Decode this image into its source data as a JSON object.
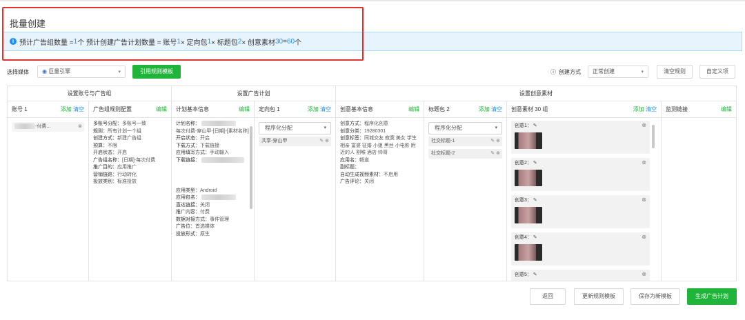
{
  "page_title": "批量创建",
  "alert": {
    "t1": "预计广告组数量 = ",
    "n1": "1",
    "t2": " 个    预计创建广告计划数量 = 账号 ",
    "n2": "1",
    "t3": " × 定向包 ",
    "n3": "1",
    "t4": " × 标题包 ",
    "n4": "2",
    "t5": " × 创意素材 ",
    "n5": "30",
    "t6": " = ",
    "n6": "60",
    "t7": " 个"
  },
  "toolbar": {
    "media_label": "选择媒体",
    "media_value": "巨量引擎",
    "template_btn": "引用规则模板",
    "help_label": "创建方式",
    "mode_value": "正常创建",
    "clear_btn": "清空规则",
    "custom_btn": "自定义项"
  },
  "groups": {
    "g1": "设置账号与广告组",
    "g2": "设置广告计划",
    "g3": "设置创意素材"
  },
  "cols": {
    "account": {
      "title": "账号 1",
      "add": "添加",
      "clear": "清空",
      "item_suffix": "-付费..."
    },
    "adgroup": {
      "title": "广告组规则配置",
      "edit": "编辑",
      "rows": [
        [
          "多账号分配：",
          "多账号一致"
        ],
        [
          "规则：",
          "所有计划一个组"
        ],
        [
          "创建方式：",
          "新建广告组"
        ],
        [
          "预算：",
          "不限"
        ],
        [
          "开启状态：",
          "开启"
        ],
        [
          "广告组名称：",
          "[日期]-每次付费"
        ],
        [
          "推广目的：",
          "应用推广"
        ],
        [
          "营销链路：",
          "行动转化"
        ],
        [
          "投放类别：",
          "标准投放"
        ]
      ]
    },
    "plan": {
      "title": "计划基本信息",
      "edit": "编辑",
      "rows": [
        [
          "计划名称：",
          ""
        ],
        [
          "",
          "每次付费-穿山甲-[日期]-[素材名称]"
        ],
        [
          "开启状态：",
          "开启"
        ],
        [
          "下载方式：",
          "下载链接"
        ],
        [
          "应用填写方式：",
          "手动输入"
        ],
        [
          "下载链接：",
          ""
        ],
        [
          "应用类型：",
          "Android"
        ],
        [
          "应用包名：",
          ""
        ],
        [
          "直达链接：",
          "关闭"
        ],
        [
          "推广内容：",
          "付费"
        ],
        [
          "数据对接方式：",
          "事件管理"
        ],
        [
          "广告位：",
          "首选媒体"
        ],
        [
          "投放形式：",
          "原生"
        ]
      ]
    },
    "target": {
      "title": "定向包 1",
      "add": "添加",
      "clear": "清空",
      "select": "程序化分配",
      "chip": "共享-穿山甲"
    },
    "creative": {
      "title": "创意基本信息",
      "edit": "编辑",
      "rows": [
        [
          "创意方式：",
          "程序化创意"
        ],
        [
          "创意分类：",
          "19280301"
        ],
        [
          "创意标签：",
          "同城交友 寂寞 美女 学生 相亲 富婆 征婚 小姐 黑丝 小电影 附近的人 割喉 酒店 帅哥"
        ],
        [
          "应用名：",
          "畅道"
        ],
        [
          "副标题：",
          ""
        ],
        [
          "自动生成视频素材：",
          "不启用"
        ],
        [
          "广告评论：",
          "关闭"
        ]
      ]
    },
    "titles": {
      "title": "标题包 2",
      "add": "添加",
      "clear": "清空",
      "select": "程序化分配",
      "chips": [
        "社交标题-1",
        "社交标题-2"
      ]
    },
    "material": {
      "title": "创意素材 30 组",
      "add": "添加",
      "clear": "清空",
      "cards": [
        "创意1：",
        "创意2：",
        "创意3：",
        "创意4：",
        "创意5："
      ]
    },
    "monitor": {
      "title": "监测链接",
      "edit": "编辑"
    }
  },
  "footer": {
    "back": "返回",
    "update": "更新规则模板",
    "save": "保存为新模板",
    "generate": "生成广告计划"
  },
  "colors": {
    "accent_green": "#20b43a",
    "accent_blue": "#1e90ef",
    "highlight_red": "#e0322f"
  }
}
